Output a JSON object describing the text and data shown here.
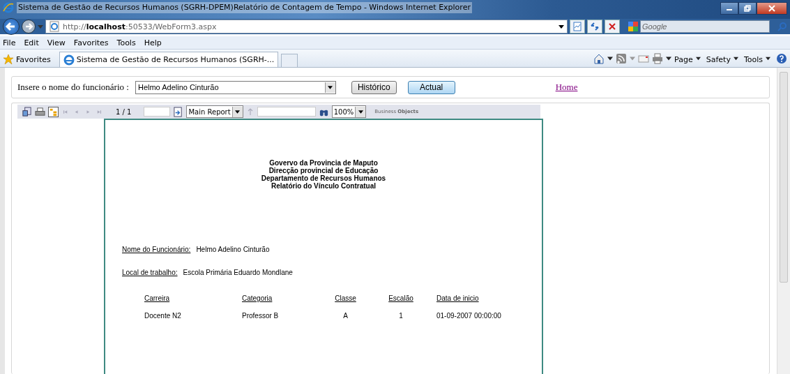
{
  "window": {
    "title": "Sistema de Gestão de Recursos Humanos (SGRH-DPEM)Relatório de Contagem de Tempo - Windows Internet Explorer"
  },
  "address_bar": {
    "url": "http://**localhost**:50533/WebForm3.aspx"
  },
  "search": {
    "placeholder": "Google"
  },
  "menu": [
    "File",
    "Edit",
    "View",
    "Favorites",
    "Tools",
    "Help"
  ],
  "favorites_bar": {
    "label": "Favorites",
    "tabs": [
      {
        "label": "Sistema de Gestão de Recursos Humanos (SGRH-...",
        "selected": true
      }
    ]
  },
  "command_bar": [
    "Page",
    "Safety",
    "Tools"
  ],
  "form": {
    "label": "Insere o nome do funcionário :",
    "employee": "Helmo Adelino Cinturão",
    "buttons": [
      {
        "label": "Histórico",
        "highlighted": false
      },
      {
        "label": "Actual",
        "highlighted": true
      }
    ],
    "home_link": "Home"
  },
  "viewer_toolbar": {
    "page": "1 / 1",
    "report": "Main Report",
    "zoom": "100%",
    "brand": "Business **Objects**"
  },
  "report": {
    "header": [
      "Govervo da Provincia de Maputo",
      "Direcção provincial de Educação",
      "Departamento de Recursos Humanos",
      "Relatório do Vínculo Contratual"
    ],
    "fields": [
      {
        "label": "Nome do  Funcionário:",
        "value": "Helmo Adelino Cinturão"
      },
      {
        "label": "Local de trabalho:",
        "value": "Escola Primária Eduardo Mondlane"
      }
    ],
    "columns": [
      "Carreira",
      "Categoria",
      "Classe",
      "Escalão",
      "Data de inicio"
    ],
    "rows": [
      [
        "Docente N2",
        "Professor B",
        "A",
        "1",
        "01-09-2007  00:00:00"
      ]
    ]
  }
}
